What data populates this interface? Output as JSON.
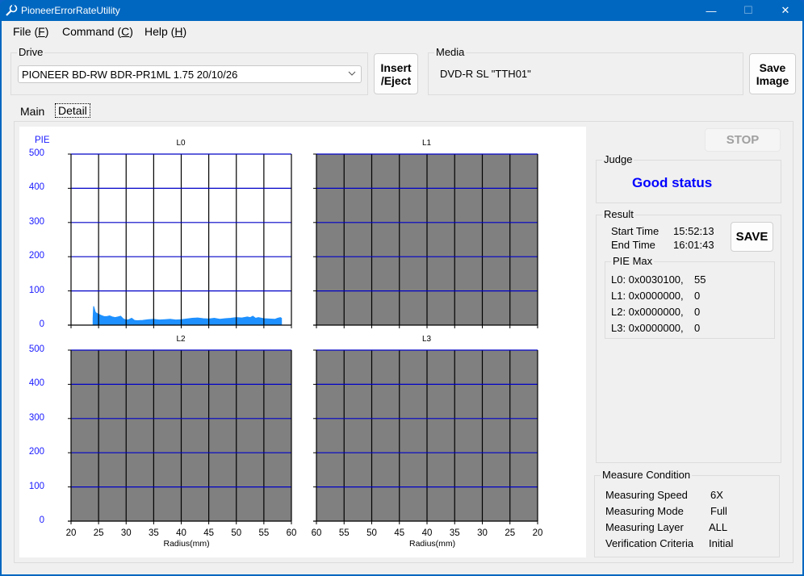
{
  "window": {
    "title": "PioneerErrorRateUtility",
    "controls": {
      "minimize": "—",
      "maximize": "☐",
      "close": "✕"
    }
  },
  "menu": [
    {
      "label": "File (",
      "key": "F",
      "suffix": ")"
    },
    {
      "label": "Command (",
      "key": "C",
      "suffix": ")"
    },
    {
      "label": "Help (",
      "key": "H",
      "suffix": ")"
    }
  ],
  "drive": {
    "group_label": "Drive",
    "selected": "PIONEER BD-RW BDR-PR1ML 1.75 20/10/26",
    "insert_eject_label_1": "Insert",
    "insert_eject_label_2": "/Eject"
  },
  "media": {
    "group_label": "Media",
    "value": "DVD-R SL \"TTH01\"",
    "save_image_label_1": "Save",
    "save_image_label_2": "Image"
  },
  "tabs": [
    {
      "label": "Main",
      "active": false
    },
    {
      "label": "Detail",
      "active": true
    }
  ],
  "stop_label": "STOP",
  "judge": {
    "group_label": "Judge",
    "status": "Good status",
    "status_color": "#0000ff"
  },
  "result": {
    "group_label": "Result",
    "start_time_label": "Start Time",
    "start_time": "15:52:13",
    "end_time_label": "End Time",
    "end_time": "16:01:43",
    "save_label": "SAVE",
    "pie_max": {
      "group_label": "PIE Max",
      "rows": [
        {
          "layer": "L0: 0x0030100,",
          "value": "55"
        },
        {
          "layer": "L1: 0x0000000,",
          "value": "0"
        },
        {
          "layer": "L2: 0x0000000,",
          "value": "0"
        },
        {
          "layer": "L3: 0x0000000,",
          "value": "0"
        }
      ]
    }
  },
  "measure_condition": {
    "group_label": "Measure Condition",
    "rows": [
      {
        "label": "Measuring Speed",
        "value": "6X"
      },
      {
        "label": "Measuring Mode",
        "value": "Full"
      },
      {
        "label": "Measuring Layer",
        "value": "ALL"
      },
      {
        "label": "Verification Criteria",
        "value": "Initial"
      }
    ]
  },
  "chart_data": [
    {
      "type": "area",
      "title": "L0",
      "ylabel": "PIE",
      "xlabel": "Radius(mm)",
      "xlim": [
        20,
        60
      ],
      "ylim": [
        0,
        500
      ],
      "x_ticks": [
        "20",
        "25",
        "30",
        "35",
        "40",
        "45",
        "50",
        "55",
        "60"
      ],
      "y_ticks": [
        "0",
        "100",
        "200",
        "300",
        "400",
        "500"
      ],
      "grid": true,
      "background": "#ffffff",
      "series": [
        {
          "name": "PIE",
          "color": "#1e90ff",
          "x": [
            24.0,
            24.1,
            24.2,
            24.4,
            24.6,
            25.0,
            25.5,
            26.0,
            26.5,
            27.0,
            27.5,
            28.0,
            28.5,
            29.0,
            29.5,
            30.0,
            30.5,
            31.0,
            31.5,
            32.0,
            33.0,
            34.0,
            35.0,
            36.0,
            37.0,
            38.0,
            39.0,
            40.0,
            41.0,
            42.0,
            43.0,
            44.0,
            45.0,
            46.0,
            47.0,
            48.0,
            49.0,
            50.0,
            51.0,
            52.0,
            52.5,
            53.0,
            53.5,
            54.0,
            55.0,
            56.0,
            57.0,
            57.5,
            58.0,
            58.2
          ],
          "values": [
            20,
            55,
            50,
            38,
            35,
            32,
            28,
            25,
            25,
            27,
            24,
            22,
            24,
            26,
            18,
            15,
            16,
            20,
            14,
            13,
            14,
            16,
            17,
            15,
            16,
            17,
            15,
            16,
            18,
            20,
            21,
            19,
            18,
            20,
            17,
            19,
            20,
            22,
            21,
            24,
            22,
            26,
            20,
            22,
            19,
            18,
            17,
            20,
            22,
            20
          ]
        }
      ]
    },
    {
      "type": "area",
      "title": "L1",
      "xlabel": "Radius(mm)",
      "xlim": [
        60,
        20
      ],
      "ylim": [
        0,
        500
      ],
      "x_ticks": [
        "60",
        "55",
        "50",
        "45",
        "40",
        "35",
        "30",
        "25",
        "20"
      ],
      "grid": true,
      "background": "#808080",
      "series": []
    },
    {
      "type": "area",
      "title": "L2",
      "ylabel": "PIE",
      "xlabel": "Radius(mm)",
      "xlim": [
        20,
        60
      ],
      "ylim": [
        0,
        500
      ],
      "x_ticks": [
        "20",
        "25",
        "30",
        "35",
        "40",
        "45",
        "50",
        "55",
        "60"
      ],
      "y_ticks": [
        "0",
        "100",
        "200",
        "300",
        "400",
        "500"
      ],
      "grid": true,
      "background": "#808080",
      "series": []
    },
    {
      "type": "area",
      "title": "L3",
      "xlabel": "Radius(mm)",
      "xlim": [
        60,
        20
      ],
      "ylim": [
        0,
        500
      ],
      "x_ticks": [
        "60",
        "55",
        "50",
        "45",
        "40",
        "35",
        "30",
        "25",
        "20"
      ],
      "grid": true,
      "background": "#808080",
      "series": []
    }
  ]
}
